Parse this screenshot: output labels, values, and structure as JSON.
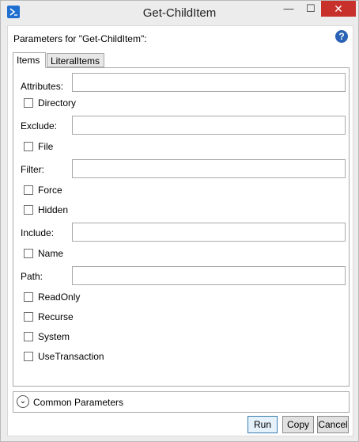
{
  "window": {
    "title": "Get-ChildItem",
    "minimize": "—",
    "maximize": "☐",
    "close": "✕"
  },
  "header": {
    "params_label": "Parameters for \"Get-ChildItem\":",
    "help": "?"
  },
  "tabs": [
    {
      "label": "Items"
    },
    {
      "label": "LiteralItems"
    }
  ],
  "fields": {
    "attributes": {
      "label": "Attributes:",
      "value": ""
    },
    "exclude": {
      "label": "Exclude:",
      "value": ""
    },
    "filter": {
      "label": "Filter:",
      "value": ""
    },
    "include": {
      "label": "Include:",
      "value": ""
    },
    "path": {
      "label": "Path:",
      "value": ""
    }
  },
  "checkboxes": {
    "directory": {
      "label": "Directory",
      "checked": false
    },
    "file": {
      "label": "File",
      "checked": false
    },
    "force": {
      "label": "Force",
      "checked": false
    },
    "hidden": {
      "label": "Hidden",
      "checked": false
    },
    "name": {
      "label": "Name",
      "checked": false
    },
    "readonly": {
      "label": "ReadOnly",
      "checked": false
    },
    "recurse": {
      "label": "Recurse",
      "checked": false
    },
    "system": {
      "label": "System",
      "checked": false
    },
    "usetransaction": {
      "label": "UseTransaction",
      "checked": false
    }
  },
  "common": {
    "label": "Common Parameters"
  },
  "buttons": {
    "run": "Run",
    "copy": "Copy",
    "cancel": "Cancel"
  },
  "colors": {
    "close_button": "#c8302b",
    "help_icon": "#2a63b5",
    "app_icon": "#1f6fd0"
  }
}
